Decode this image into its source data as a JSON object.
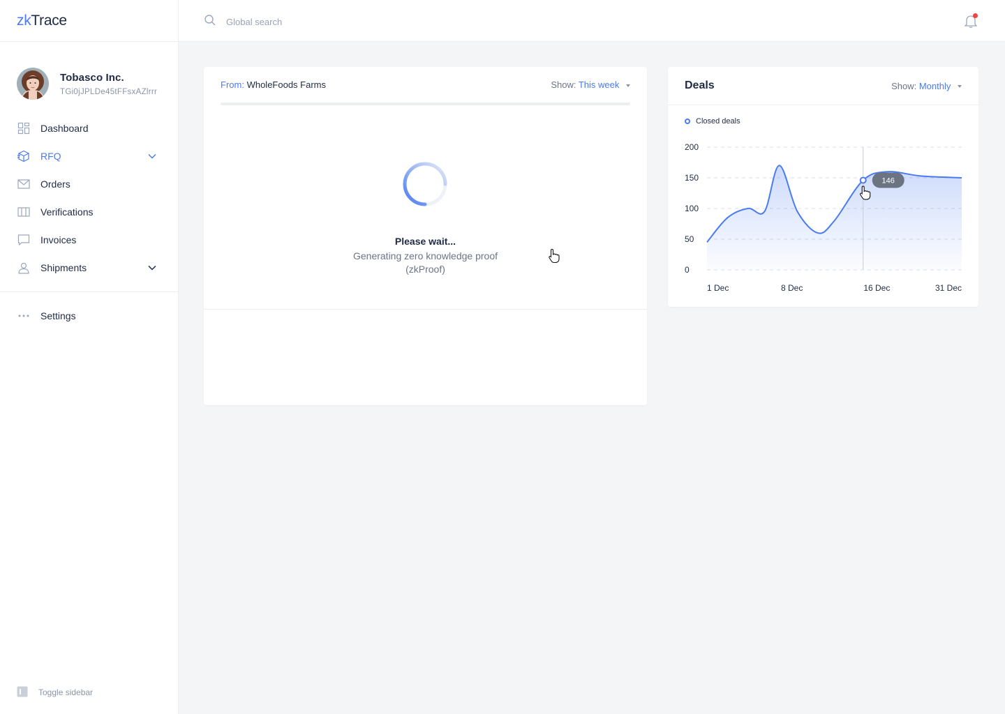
{
  "app": {
    "logo_prefix": "zk",
    "logo_suffix": "Trace"
  },
  "profile": {
    "company": "Tobasco Inc.",
    "address": "TGi0jJPLDe45tFFsxAZlrrr"
  },
  "nav": {
    "items": [
      {
        "label": "Dashboard",
        "icon": "grid-icon"
      },
      {
        "label": "RFQ",
        "icon": "box-icon",
        "active": true,
        "expandable": true
      },
      {
        "label": "Orders",
        "icon": "mail-icon"
      },
      {
        "label": "Verifications",
        "icon": "columns-icon"
      },
      {
        "label": "Invoices",
        "icon": "chat-icon"
      },
      {
        "label": "Shipments",
        "icon": "user-icon",
        "expandable": true
      }
    ],
    "settings": "Settings",
    "toggle": "Toggle sidebar"
  },
  "search": {
    "placeholder": "Global search"
  },
  "proof_card": {
    "from_label": "From:",
    "from_value": "WholeFoods Farms",
    "show_label": "Show:",
    "show_value": "This week",
    "wait_title": "Please wait...",
    "wait_subtitle": "Generating zero knowledge proof (zkProof)"
  },
  "deals_card": {
    "title": "Deals",
    "show_label": "Show:",
    "show_value": "Monthly"
  },
  "colors": {
    "accent": "#4a7bf0",
    "notification": "#ef4444",
    "tooltip": "#6b7480"
  },
  "chart_data": {
    "type": "area",
    "series": [
      {
        "name": "Closed deals",
        "points": [
          [
            0,
            45
          ],
          [
            2.5,
            85
          ],
          [
            5,
            100
          ],
          [
            7,
            95
          ],
          [
            8.8,
            170
          ],
          [
            11,
            95
          ],
          [
            13.5,
            60
          ],
          [
            15.5,
            80
          ],
          [
            19,
            146
          ],
          [
            22,
            160
          ],
          [
            26,
            153
          ],
          [
            31,
            150
          ]
        ]
      }
    ],
    "x_ticks": [
      "1 Dec",
      "8 Dec",
      "16 Dec",
      "31 Dec"
    ],
    "y_ticks": [
      0,
      50,
      100,
      150,
      200
    ],
    "ylim": [
      0,
      200
    ],
    "xlim": [
      0,
      31
    ],
    "highlight": {
      "x": 19,
      "y": 146,
      "label": "146"
    },
    "grid": "horizontal dashed",
    "legend": "top-left"
  }
}
